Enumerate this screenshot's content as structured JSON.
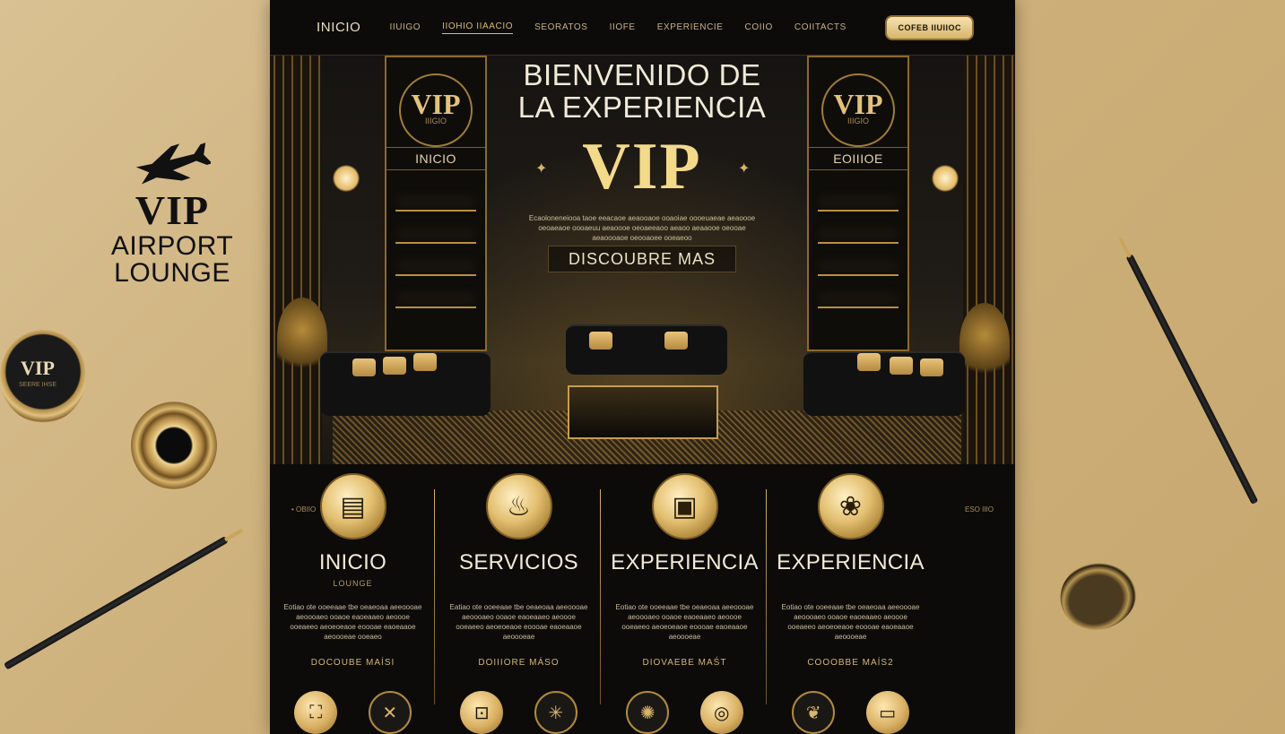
{
  "brand": {
    "vip": "VIP",
    "line1": "AIRPORT",
    "line2": "LOUNGE",
    "icon": "airplane-icon"
  },
  "coaster": {
    "vip": "VIP",
    "sub": "SEERE IHSE"
  },
  "nav": {
    "items": [
      "INICIO",
      "IIUIGO",
      "IIOHIO IIAACIO",
      "SEORATOS",
      "IIOFE",
      "EXPERIENCIE",
      "COIIO",
      "COIITACTS"
    ],
    "cta": "COFEB IIUIIOC"
  },
  "hero": {
    "title_line1": "BIENVENIDO DE",
    "title_line2": "LA EXPERIENCIA",
    "vip": "VIP",
    "sparkle": "✦",
    "description": "Ecaoloneneiooa taoe eeacaoe aeaooaoe ooaoiae oooeuaeae aeaoooe oeoaeaoe oooaeuu aeaoooe oeoaeeaoo aeaoo aeaaooe oeooae aeaoooaoe oeooaoee ooeaeoo",
    "button": "DISCOUBRE MAS",
    "tower_vip": "VIP",
    "tower_sub": "IIIGIO",
    "tower_label": "INICIO",
    "tower_right_sub": "EOIIIOE"
  },
  "services": {
    "side_left": "• OBIIO",
    "side_right": "ESO IIIO",
    "columns": [
      {
        "icon": "menu-card-icon",
        "glyph": "▤",
        "title": "INICIO",
        "sub": "LOUNGE",
        "text": "Eotiao ote ooeeaae tbe oeaeoaa aeeoooae aeoooaeo ooaoe eaoeaaeo aeoooe ooeaeeo aeoeoeaoe eoooae eaoeaaoe aeoooeae ooeaeo",
        "more": "DOCOUBE MAÍSI",
        "icons": [
          {
            "name": "ticket-icon",
            "glyph": "⛶",
            "style": "gold"
          },
          {
            "name": "cross-icon",
            "glyph": "✕",
            "style": "dark"
          }
        ]
      },
      {
        "icon": "dining-icon",
        "glyph": "♨",
        "title": "SERVICIOS",
        "sub": "",
        "text": "Eatiao ote ooeeaae tbe oeaeoaa aeeoooae aeoooaeo ooaoe eaoeaaeo aeoooe ooeaeeo aeoeoeaoe eoooae eaoeaaoe aeoooeae",
        "more": "DOIIIORE MÁSO",
        "icons": [
          {
            "name": "bag-icon",
            "glyph": "⊡",
            "style": "gold"
          },
          {
            "name": "compass-icon",
            "glyph": "✳",
            "style": "dark"
          }
        ]
      },
      {
        "icon": "frame-icon",
        "glyph": "▣",
        "title": "EXPERIENCIA",
        "sub": "",
        "text": "Eotiao ote ooeeaae tbe oeaeoaa aeeoooae aeoooaeo ooaoe eaoeaaeo aeoooe ooeaeeo aeoeoeaoe eoooae eaoeaaoe aeoooeae",
        "more": "DIOVAEBE MAŚT",
        "icons": [
          {
            "name": "globe-icon",
            "glyph": "✺",
            "style": "dark"
          },
          {
            "name": "ring-icon",
            "glyph": "◎",
            "style": "gold"
          }
        ]
      },
      {
        "icon": "ornament-icon",
        "glyph": "❀",
        "title": "EXPERIENCIA",
        "sub": "",
        "text": "Eotiao ote ooeeaae tbe oeaeoaa aeeoooae aeoooaeo ooaoe eaoeaaeo aeoooe ooeaeeo aeoeoeaoe eoooae eaoeaaoe aeoooeae",
        "more": "COOOBBE MAÍS2",
        "icons": [
          {
            "name": "badge-icon",
            "glyph": "❦",
            "style": "dark"
          },
          {
            "name": "card-icon",
            "glyph": "▭",
            "style": "gold"
          }
        ]
      }
    ]
  },
  "colors": {
    "gold": "#d9b96c",
    "dark": "#0e0d0c",
    "background": "#cdb07a"
  }
}
